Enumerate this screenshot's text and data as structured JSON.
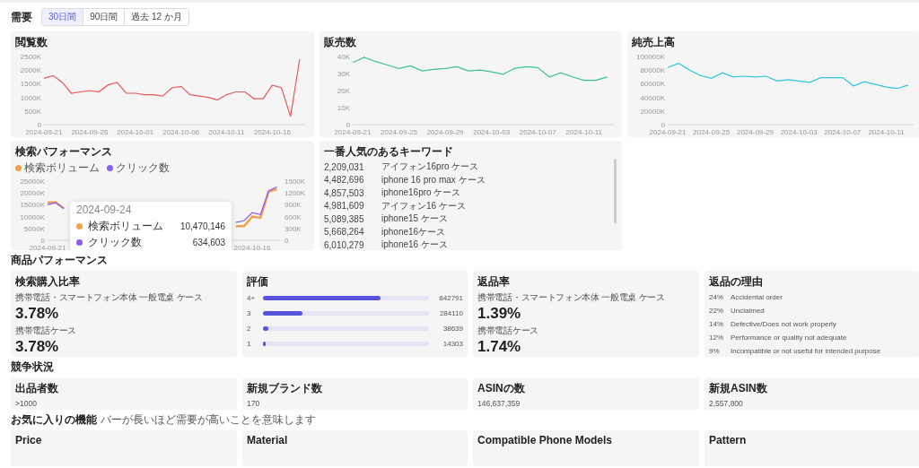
{
  "demand": {
    "title": "需要",
    "tabs": [
      {
        "label": "30日間",
        "selected": true
      },
      {
        "label": "90日間",
        "selected": false
      },
      {
        "label": "過去 12 か月",
        "selected": false
      }
    ],
    "charts": [
      {
        "title": "閲覧数",
        "chart_data": {
          "type": "line",
          "categories": [
            "2024-09-21",
            null,
            null,
            null,
            null,
            "2024-09-26",
            null,
            null,
            null,
            null,
            "2024-10-01",
            null,
            null,
            null,
            null,
            "2024-10-06",
            null,
            null,
            null,
            null,
            "2024-10-11",
            null,
            null,
            null,
            null,
            "2024-10-16",
            null,
            null,
            null
          ],
          "ylim": [
            0,
            2500
          ],
          "yticks": [
            {
              "value": 0,
              "label": "0"
            },
            {
              "value": 500,
              "label": "500K"
            },
            {
              "value": 1000,
              "label": "1000K"
            },
            {
              "value": 1500,
              "label": "1500K"
            },
            {
              "value": 2000,
              "label": "2000K"
            },
            {
              "value": 2500,
              "label": "2500K"
            }
          ],
          "series": [
            {
              "color": "#e8595a",
              "values": [
                1700,
                1800,
                1550,
                1150,
                1200,
                1250,
                1200,
                1450,
                1550,
                1150,
                1150,
                1100,
                1100,
                1050,
                1350,
                1400,
                1100,
                1050,
                1000,
                900,
                1100,
                1200,
                1200,
                950,
                950,
                1450,
                1350,
                300,
                2400
              ]
            }
          ]
        }
      },
      {
        "title": "販売数",
        "chart_data": {
          "type": "line",
          "categories": [
            "2024-09-21",
            null,
            null,
            null,
            "2024-09-25",
            null,
            null,
            null,
            "2024-09-29",
            null,
            null,
            null,
            "2024-10-03",
            null,
            null,
            null,
            "2024-10-07",
            null,
            null,
            null,
            "2024-10-11",
            null,
            null
          ],
          "ylim": [
            0,
            40
          ],
          "yticks": [
            {
              "value": 0,
              "label": "0"
            },
            {
              "value": 10,
              "label": "10K"
            },
            {
              "value": 20,
              "label": "20K"
            },
            {
              "value": 30,
              "label": "30K"
            },
            {
              "value": 40,
              "label": "40K"
            }
          ],
          "series": [
            {
              "color": "#3ec28f",
              "values": [
                36.5,
                39.5,
                37,
                35,
                33,
                34.5,
                31.5,
                32.5,
                33,
                34,
                31.5,
                32,
                31,
                29.5,
                33,
                34,
                33.5,
                28,
                30.5,
                28,
                26,
                26,
                28
              ]
            }
          ]
        }
      },
      {
        "title": "純売上高",
        "chart_data": {
          "type": "line",
          "categories": [
            "2024-09-21",
            null,
            null,
            null,
            "2024-09-25",
            null,
            null,
            null,
            "2024-09-29",
            null,
            null,
            null,
            "2024-10-03",
            null,
            null,
            null,
            "2024-10-07",
            null,
            null,
            null,
            "2024-10-11",
            null,
            null
          ],
          "ylim": [
            0,
            100000
          ],
          "yticks": [
            {
              "value": 0,
              "label": "0"
            },
            {
              "value": 20000,
              "label": "20000K"
            },
            {
              "value": 40000,
              "label": "40000K"
            },
            {
              "value": 60000,
              "label": "60000K"
            },
            {
              "value": 80000,
              "label": "80000K"
            },
            {
              "value": 100000,
              "label": "100000K"
            }
          ],
          "series": [
            {
              "color": "#2cc5dc",
              "values": [
                84000,
                90000,
                80000,
                72000,
                68000,
                76000,
                70000,
                71000,
                70000,
                71000,
                64000,
                66000,
                64000,
                62000,
                69000,
                69000,
                69000,
                57000,
                63000,
                59000,
                55000,
                53000,
                58000
              ]
            }
          ]
        }
      }
    ],
    "search": {
      "title": "検索パフォーマンス",
      "chart_data": {
        "type": "line",
        "categories": [
          "2024-09-21",
          null,
          null,
          null,
          null,
          null,
          null,
          null,
          null,
          null,
          null,
          null,
          null,
          null,
          null,
          null,
          null,
          null,
          null,
          null,
          null,
          null,
          null,
          null,
          null,
          "2024-10-16",
          null,
          null,
          null
        ],
        "ylim": [
          0,
          25000
        ],
        "yticks": [
          {
            "value": 0,
            "label": "0"
          },
          {
            "value": 5000,
            "label": "5000K"
          },
          {
            "value": 10000,
            "label": "10000K"
          },
          {
            "value": 15000,
            "label": "15000K"
          },
          {
            "value": 20000,
            "label": "20000K"
          },
          {
            "value": 25000,
            "label": "25000K"
          }
        ],
        "y2lim": [
          0,
          1500
        ],
        "y2ticks": [
          {
            "value": 0,
            "label": "0"
          },
          {
            "value": 300,
            "label": "300K"
          },
          {
            "value": 600,
            "label": "600K"
          },
          {
            "value": 900,
            "label": "900K"
          },
          {
            "value": 1200,
            "label": "1200K"
          },
          {
            "value": 1500,
            "label": "1500K"
          }
        ],
        "series": [
          {
            "name": "検索ボリューム",
            "color": "#f5a04a",
            "values": [
              16000,
              16000,
              13500,
              null,
              null,
              null,
              null,
              null,
              null,
              null,
              null,
              null,
              null,
              null,
              null,
              null,
              null,
              null,
              null,
              null,
              null,
              null,
              null,
              6000,
              6000,
              10000,
              9500,
              20500,
              21500
            ]
          },
          {
            "name": "クリック数",
            "color": "#8b5cf6",
            "axis": "y2",
            "values": [
              900,
              950,
              800,
              null,
              null,
              null,
              null,
              null,
              null,
              null,
              null,
              null,
              null,
              null,
              null,
              null,
              null,
              null,
              null,
              null,
              null,
              null,
              null,
              450,
              500,
              700,
              650,
              1250,
              1350
            ]
          }
        ]
      },
      "tooltip": {
        "date": "2024-09-24",
        "rows": [
          {
            "label": "検索ボリューム",
            "value": "10,470,146",
            "color": "#f5a04a"
          },
          {
            "label": "クリック数",
            "value": "634,603",
            "color": "#8b5cf6"
          }
        ]
      }
    },
    "keywords": {
      "title": "一番人気のあるキーワード",
      "rows": [
        {
          "count": "2,209,031",
          "keyword": "アイフォン16pro ケース"
        },
        {
          "count": "4,482,696",
          "keyword": "iphone 16 pro max ケース"
        },
        {
          "count": "4,857,503",
          "keyword": "iphone16pro ケース"
        },
        {
          "count": "4,981,609",
          "keyword": "アイフォン16 ケース"
        },
        {
          "count": "5,089,385",
          "keyword": "iphone15 ケース"
        },
        {
          "count": "5,668,264",
          "keyword": "iphone16ケース"
        },
        {
          "count": "6,010,279",
          "keyword": "iphone16 ケース"
        }
      ]
    }
  },
  "product_performance": {
    "title": "商品パフォーマンス",
    "conversion": {
      "title": "検索購入比率",
      "items": [
        {
          "category": "携帯電話・スマートフォン本体 一般電桌 ケース",
          "value": "3.78%"
        },
        {
          "category": "携帯電話ケース",
          "value": "3.78%"
        }
      ]
    },
    "ratings": {
      "title": "評価",
      "rows": [
        {
          "label": "4+",
          "level": 0.71,
          "count": "842791"
        },
        {
          "label": "3",
          "level": 0.24,
          "count": "284110"
        },
        {
          "label": "2",
          "level": 0.03,
          "count": "38639"
        },
        {
          "label": "1",
          "level": 0.01,
          "count": "14303"
        }
      ]
    },
    "returns": {
      "title": "返品率",
      "items": [
        {
          "category": "携帯電話・スマートフォン本体 一般電桌 ケース",
          "value": "1.39%"
        },
        {
          "category": "携帯電話ケース",
          "value": "1.74%"
        }
      ]
    },
    "return_reasons": {
      "title": "返品の理由",
      "rows": [
        {
          "share": "24%",
          "reason": "Accidental order"
        },
        {
          "share": "22%",
          "reason": "Unclaimed"
        },
        {
          "share": "14%",
          "reason": "Defective/Does not work properly"
        },
        {
          "share": "12%",
          "reason": "Performance or quality not adequate"
        },
        {
          "share": "9%",
          "reason": "Incompatible or not useful for intended purpose"
        }
      ]
    }
  },
  "competition": {
    "title": "競争状況",
    "cards": [
      {
        "label": "出品者数",
        "value": ">1000"
      },
      {
        "label": "新規ブランド数",
        "value": "170"
      },
      {
        "label": "ASINの数",
        "value": "146,637,359"
      },
      {
        "label": "新規ASIN数",
        "value": "2,557,800"
      }
    ]
  },
  "favorite_features": {
    "title": "お気に入りの機能",
    "hint": "バーが長いほど需要が高いことを意味します",
    "cards": [
      {
        "title": "Price"
      },
      {
        "title": "Material"
      },
      {
        "title": "Compatible Phone Models"
      },
      {
        "title": "Pattern"
      }
    ]
  }
}
